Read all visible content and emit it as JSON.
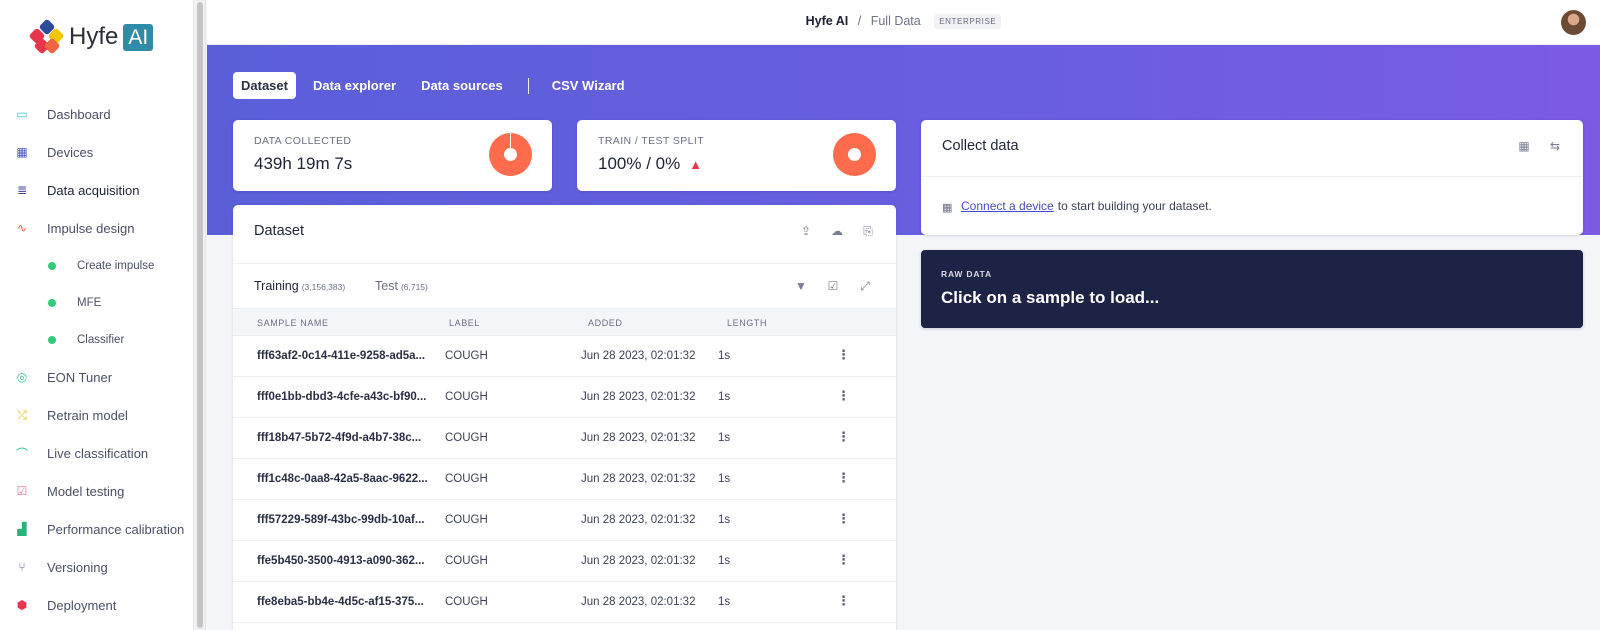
{
  "brand": {
    "name": "Hyfe",
    "badge": "AI"
  },
  "colors": {
    "accent": "#5a5fd8",
    "pie": "#fe6b4d",
    "warning": "#e5374b",
    "raw_bg": "#1d2345",
    "dot": "#2fcc7a"
  },
  "sidebar": {
    "items": [
      {
        "label": "Dashboard",
        "icon": "monitor-icon",
        "color": "#3fc1d9"
      },
      {
        "label": "Devices",
        "icon": "chip-icon",
        "color": "#4a55c9"
      },
      {
        "label": "Data acquisition",
        "icon": "database-icon",
        "color": "#3b3f9e"
      },
      {
        "label": "Impulse design",
        "icon": "pulse-icon",
        "color": "#f06343"
      },
      {
        "label": "Create impulse",
        "sub": true
      },
      {
        "label": "MFE",
        "sub": true
      },
      {
        "label": "Classifier",
        "sub": true
      },
      {
        "label": "EON Tuner",
        "icon": "compass-icon",
        "color": "#2fc48a"
      },
      {
        "label": "Retrain model",
        "icon": "shuffle-icon",
        "color": "#e8b800"
      },
      {
        "label": "Live classification",
        "icon": "wave-icon",
        "color": "#25b98a"
      },
      {
        "label": "Model testing",
        "icon": "clipboard-check-icon",
        "color": "#ef6b8b"
      },
      {
        "label": "Performance calibration",
        "icon": "bar-chart-icon",
        "color": "#27b37a"
      },
      {
        "label": "Versioning",
        "icon": "branch-icon",
        "color": "#5b5fd0"
      },
      {
        "label": "Deployment",
        "icon": "box-icon",
        "color": "#e8354e"
      }
    ]
  },
  "topbar": {
    "org": "Hyfe AI",
    "sep": "/",
    "project": "Full Data",
    "tier": "ENTERPRISE"
  },
  "tabs": [
    {
      "label": "Dataset",
      "active": true
    },
    {
      "label": "Data explorer"
    },
    {
      "label": "Data sources"
    },
    {
      "label": "CSV Wizard"
    }
  ],
  "stats": {
    "collected": {
      "label": "DATA COLLECTED",
      "value": "439h 19m 7s"
    },
    "split": {
      "label": "TRAIN / TEST SPLIT",
      "value": "100% / 0%",
      "warning_icon": "warning-icon"
    }
  },
  "dataset": {
    "title": "Dataset",
    "icons": [
      "upload-icon",
      "cloud-upload-icon",
      "download-file-icon"
    ],
    "training": {
      "label": "Training",
      "count": "(3,156,383)"
    },
    "test": {
      "label": "Test",
      "count": "(6,715)"
    },
    "tool_icons": [
      "filter-icon",
      "checkbox-icon",
      "expand-icon"
    ],
    "columns": [
      "SAMPLE NAME",
      "LABEL",
      "ADDED",
      "LENGTH"
    ],
    "rows": [
      {
        "name": "fff63af2-0c14-411e-9258-ad5a...",
        "label": "COUGH",
        "added": "Jun 28 2023, 02:01:32",
        "length": "1s"
      },
      {
        "name": "fff0e1bb-dbd3-4cfe-a43c-bf90...",
        "label": "COUGH",
        "added": "Jun 28 2023, 02:01:32",
        "length": "1s"
      },
      {
        "name": "fff18b47-5b72-4f9d-a4b7-38c...",
        "label": "COUGH",
        "added": "Jun 28 2023, 02:01:32",
        "length": "1s"
      },
      {
        "name": "fff1c48c-0aa8-42a5-8aac-9622...",
        "label": "COUGH",
        "added": "Jun 28 2023, 02:01:32",
        "length": "1s"
      },
      {
        "name": "fff57229-589f-43bc-99db-10af...",
        "label": "COUGH",
        "added": "Jun 28 2023, 02:01:32",
        "length": "1s"
      },
      {
        "name": "ffe5b450-3500-4913-a090-362...",
        "label": "COUGH",
        "added": "Jun 28 2023, 02:01:32",
        "length": "1s"
      },
      {
        "name": "ffe8eba5-bb4e-4d5c-af15-375...",
        "label": "COUGH",
        "added": "Jun 28 2023, 02:01:32",
        "length": "1s"
      }
    ]
  },
  "collect": {
    "title": "Collect data",
    "icons": [
      "chip-icon",
      "usb-icon"
    ],
    "link": "Connect a device",
    "text": "to start building your dataset."
  },
  "raw": {
    "label": "RAW DATA",
    "title": "Click on a sample to load..."
  }
}
